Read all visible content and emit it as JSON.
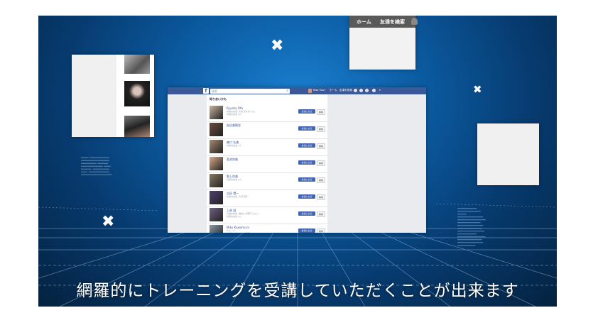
{
  "caption": "網羅的にトレーニングを受講していただくことが出来ます",
  "top_right_window": {
    "nav_home": "ホーム",
    "nav_find_friends": "友達を検索"
  },
  "fb_window": {
    "search_placeholder": "検索",
    "nav_user": "Mao Tsuri",
    "nav_home": "ホーム",
    "nav_find_friends": "友達を検索",
    "section_title": "知り合いかも",
    "add_label": "友達になる",
    "remove_label": "削除",
    "people": [
      {
        "name": "Ryusho Ota",
        "sub": "共通の友達: 大谷 まなみ さん…",
        "sub2": "共通の友達 2人"
      },
      {
        "name": "桜田美穂里",
        "sub": "",
        "sub2": ""
      },
      {
        "name": "森口 弘美",
        "sub": "共通の友達 1人",
        "sub2": ""
      },
      {
        "name": "菊池知美",
        "sub": "",
        "sub2": ""
      },
      {
        "name": "野上尚美",
        "sub": "共通の友達 1人",
        "sub2": ""
      },
      {
        "name": "吉田 潤一",
        "sub": "共通の友達: 大石 潤子",
        "sub2": ""
      },
      {
        "name": "上原 誠",
        "sub": "共通の友達: 長谷川 寿美子さんと…",
        "sub2": "共通の友達 2人"
      },
      {
        "name": "Miku Kawamura",
        "sub": "グループ",
        "sub2": "共通の友達: 吉村 友里子"
      }
    ]
  },
  "colors": {
    "fb_blue": "#3b5998",
    "button_blue": "#4267b2",
    "background_blue": "#0b5aa0"
  },
  "icons": {
    "close": "close-icon",
    "search": "search-icon",
    "logo": "facebook-logo-icon"
  }
}
